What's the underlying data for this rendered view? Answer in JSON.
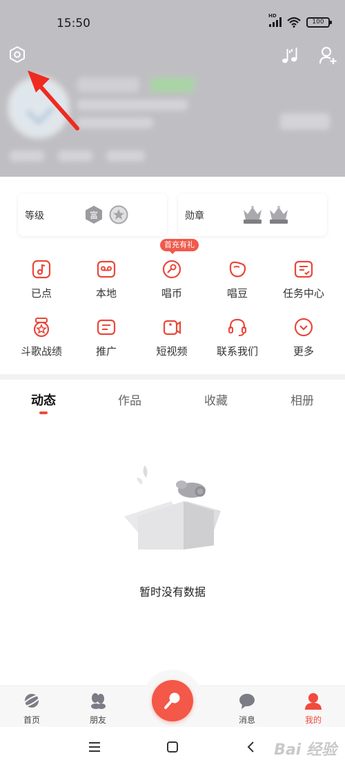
{
  "status_bar": {
    "time": "15:50",
    "network_badge": "HD",
    "battery": "100"
  },
  "cards": {
    "level_label": "等级",
    "level_badge_text": "富",
    "medal_label": "勋章"
  },
  "promo_tag": "首充有礼",
  "grid": [
    {
      "label": "已点",
      "icon": "music-note-icon"
    },
    {
      "label": "本地",
      "icon": "cassette-icon"
    },
    {
      "label": "唱币",
      "icon": "coin-icon"
    },
    {
      "label": "唱豆",
      "icon": "bean-icon"
    },
    {
      "label": "任务中心",
      "icon": "task-icon"
    },
    {
      "label": "斗歌战绩",
      "icon": "trophy-icon"
    },
    {
      "label": "推广",
      "icon": "promote-icon"
    },
    {
      "label": "短视频",
      "icon": "video-icon"
    },
    {
      "label": "联系我们",
      "icon": "headset-icon"
    },
    {
      "label": "更多",
      "icon": "chevron-down-icon"
    }
  ],
  "tabs": [
    {
      "label": "动态",
      "active": true
    },
    {
      "label": "作品",
      "active": false
    },
    {
      "label": "收藏",
      "active": false
    },
    {
      "label": "相册",
      "active": false
    }
  ],
  "empty_state": {
    "message": "暂时没有数据"
  },
  "bottom_nav": [
    {
      "label": "首页",
      "icon": "planet-icon",
      "active": false
    },
    {
      "label": "朋友",
      "icon": "friends-icon",
      "active": false
    },
    {
      "label": "消息",
      "icon": "message-icon",
      "active": false
    },
    {
      "label": "我的",
      "icon": "profile-icon",
      "active": true
    }
  ],
  "watermark": "Bai 经验",
  "colors": {
    "accent": "#f04b3c",
    "header_bg": "#bfbfc3",
    "icon_red": "#e9473a"
  }
}
